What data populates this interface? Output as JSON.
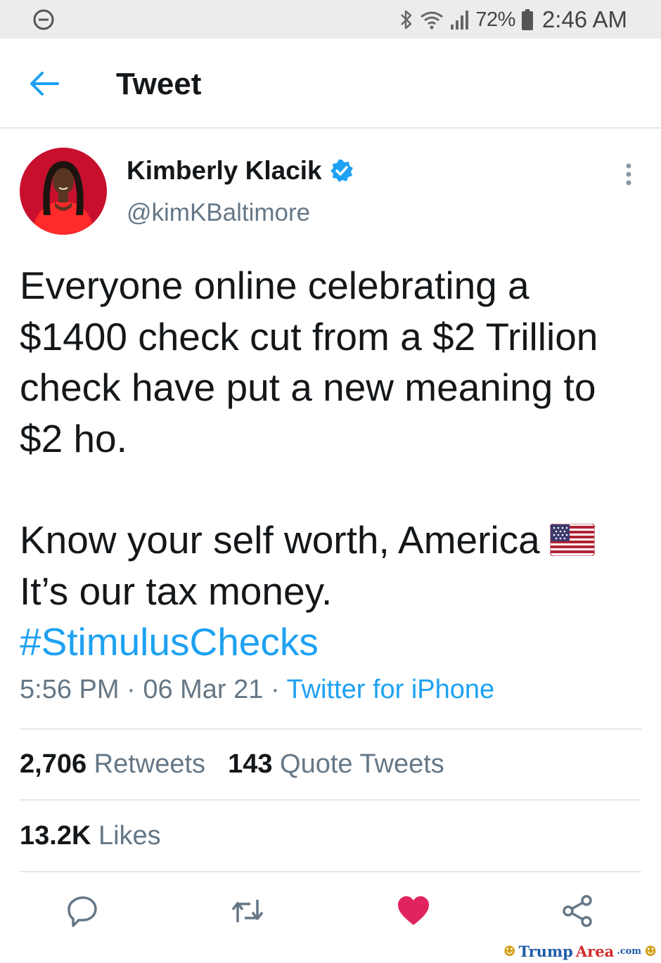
{
  "status_bar": {
    "battery_percent": "72%",
    "time": "2:46 AM",
    "icons": [
      "do-not-disturb-icon",
      "bluetooth-icon",
      "wifi-icon",
      "signal-icon",
      "battery-icon"
    ]
  },
  "header": {
    "title": "Tweet",
    "back_icon": "back-arrow-icon"
  },
  "tweet": {
    "author": {
      "name": "Kimberly Klacik",
      "handle": "@kimKBaltimore",
      "verified": true
    },
    "lines": [
      "Everyone online celebrating a",
      "$1400 check cut from a $2 Trillion",
      "check have put a new meaning to",
      "$2 ho.",
      "Know your self worth, America",
      "It’s our tax money."
    ],
    "hashtag": "#StimulusChecks",
    "time": "5:56 PM",
    "date": "06 Mar 21",
    "separator": " · ",
    "source": "Twitter for iPhone",
    "stats": {
      "retweets_count": "2,706",
      "retweets_label": " Retweets",
      "quotes_count": "143",
      "quotes_label": " Quote Tweets",
      "likes_count": "13.2K",
      "likes_label": " Likes"
    },
    "actions": [
      "reply-icon",
      "retweet-icon",
      "like-icon",
      "share-icon"
    ],
    "liked": true
  },
  "watermark": {
    "part1": "Trump",
    "part2": "Area",
    "part3": ".com"
  },
  "colors": {
    "twitter_blue": "#1da1f2",
    "like_red": "#e0245e",
    "secondary_text": "#657786",
    "divider": "#e1e8ed",
    "status_bar_bg": "#ececec"
  }
}
